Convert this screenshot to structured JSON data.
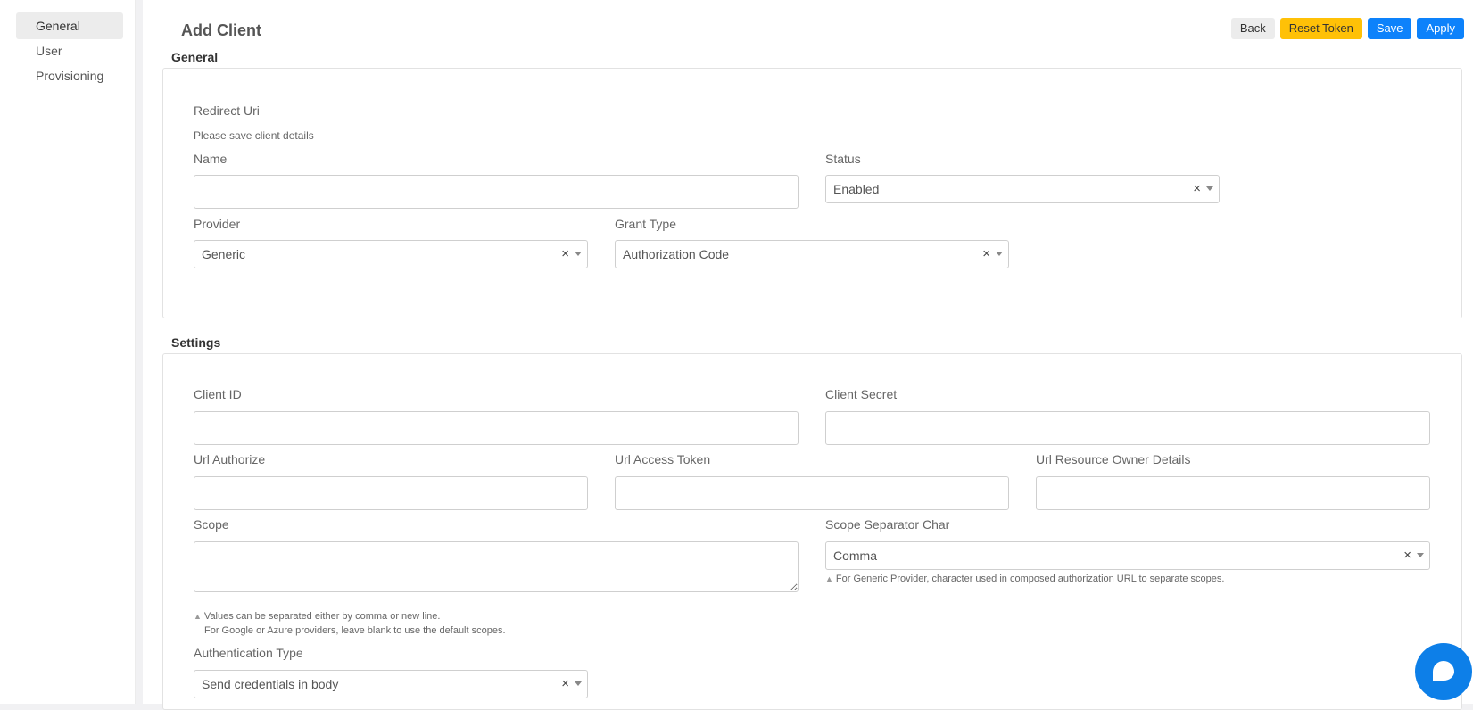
{
  "sidebar": {
    "items": [
      {
        "label": "General",
        "active": true
      },
      {
        "label": "User",
        "active": false
      },
      {
        "label": "Provisioning",
        "active": false
      }
    ]
  },
  "header": {
    "title": "Add Client",
    "buttons": {
      "back": "Back",
      "reset_token": "Reset Token",
      "save": "Save",
      "apply": "Apply"
    }
  },
  "general": {
    "section_title": "General",
    "redirect_uri_label": "Redirect Uri",
    "redirect_uri_note": "Please save client details",
    "name_label": "Name",
    "name_value": "",
    "status_label": "Status",
    "status_value": "Enabled",
    "provider_label": "Provider",
    "provider_value": "Generic",
    "grant_type_label": "Grant Type",
    "grant_type_value": "Authorization Code"
  },
  "settings": {
    "section_title": "Settings",
    "client_id_label": "Client ID",
    "client_secret_label": "Client Secret",
    "url_authorize_label": "Url Authorize",
    "url_access_token_label": "Url Access Token",
    "url_resource_owner_label": "Url Resource Owner Details",
    "scope_label": "Scope",
    "scope_hint_line1": "Values can be separated either by comma or new line.",
    "scope_hint_line2": "For Google or Azure providers, leave blank to use the default scopes.",
    "scope_separator_label": "Scope Separator Char",
    "scope_separator_value": "Comma",
    "scope_separator_hint": "For Generic Provider, character used in composed authorization URL to separate scopes.",
    "auth_type_label": "Authentication Type",
    "auth_type_value": "Send credentials in body"
  },
  "icons": {
    "clear": "×",
    "hint_marker": "▲"
  },
  "colors": {
    "primary": "#0d82fb",
    "warning": "#ffc107",
    "chat": "#0d7fe8"
  }
}
